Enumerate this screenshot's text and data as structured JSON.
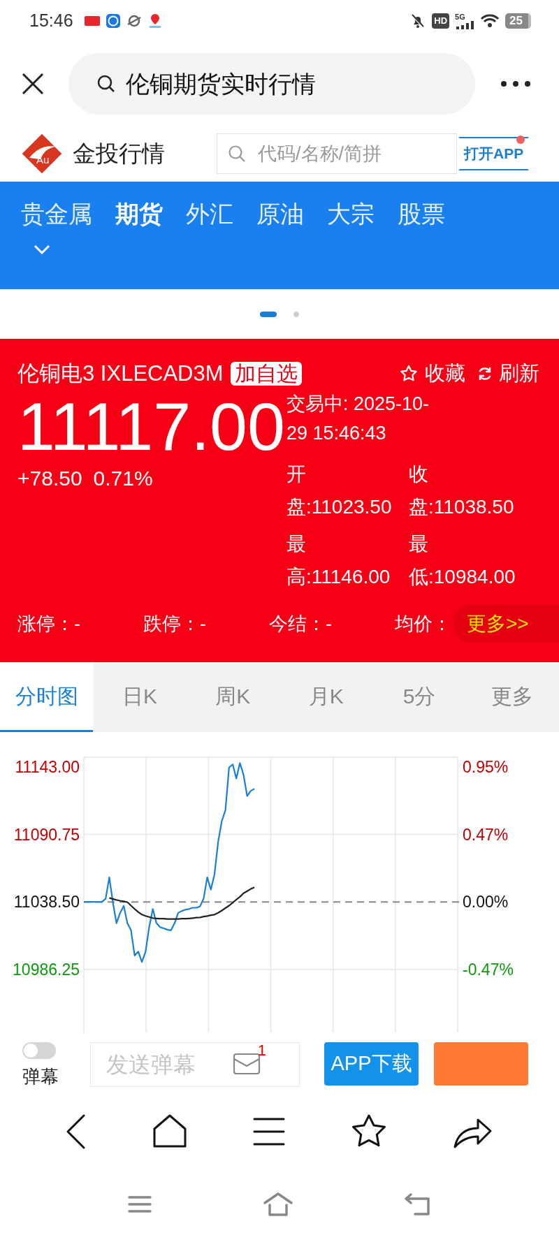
{
  "status_bar": {
    "time": "15:46",
    "hd": "HD",
    "network": "5G",
    "battery": "25"
  },
  "browser_bar": {
    "query": "伦铜期货实时行情"
  },
  "site_header": {
    "logo_mark": "Au",
    "site_name": "金投行情",
    "search": {
      "placeholder": "代码/名称/简拼"
    },
    "open_app": "打开APP"
  },
  "category_nav": {
    "items": [
      {
        "label": "贵金属",
        "selected": false
      },
      {
        "label": "期货",
        "selected": true
      },
      {
        "label": "外汇",
        "selected": false
      },
      {
        "label": "原油",
        "selected": false
      },
      {
        "label": "大宗",
        "selected": false
      },
      {
        "label": "股票",
        "selected": false
      }
    ]
  },
  "carousel": {
    "pages": [
      {
        "selected": true
      },
      {
        "selected": false
      }
    ]
  },
  "quote": {
    "name": "伦铜电3 IXLECAD3M",
    "watch_button": "加自选",
    "favorite": "收藏",
    "refresh": "刷新",
    "price": "11117.00",
    "change": "+78.50",
    "change_pct": "0.71%",
    "status": "交易中: 2025-10-29 15:46:43",
    "stats": [
      "开盘:11023.50",
      "收盘:11038.50",
      "最高:11146.00",
      "最低:10984.00"
    ],
    "limits": [
      "涨停：-",
      "跌停：-",
      "今结：-",
      "均价："
    ],
    "more": "更多>>"
  },
  "chart_tabs": [
    {
      "label": "分时图",
      "selected": true
    },
    {
      "label": "日K",
      "selected": false
    },
    {
      "label": "周K",
      "selected": false
    },
    {
      "label": "月K",
      "selected": false
    },
    {
      "label": "5分",
      "selected": false
    },
    {
      "label": "更多",
      "selected": false
    }
  ],
  "chart": {
    "chart_data": {
      "type": "line",
      "ylim": [
        10938,
        11150.5
      ],
      "yticks": [
        {
          "value": 11143,
          "label": "11143.00"
        },
        {
          "value": 11090.75,
          "label": "11090.75"
        },
        {
          "value": 11038.5,
          "label": "11038.50"
        },
        {
          "value": 10986.25,
          "label": "10986.25"
        }
      ],
      "series": [
        {
          "color": "#1a7fd4",
          "values": [
            11038.5,
            11038.5,
            11038.5,
            11038.5,
            11038.5,
            11038.5,
            11041,
            11057.5,
            11038,
            11022,
            11030,
            11035.5,
            11022,
            11016.5,
            10997,
            11000,
            10992,
            11000,
            11019,
            11033,
            11022,
            11019,
            11018,
            11017,
            11016.5,
            11022,
            11030,
            11031.5,
            11032.5,
            11033,
            11034,
            11034,
            11035,
            11041,
            11057.5,
            11048,
            11060,
            11085,
            11101,
            11109.5,
            11142.5,
            11145,
            11134,
            11146,
            11137,
            11120.5,
            11124.5,
            11126,
            null,
            null,
            null,
            null,
            null,
            null,
            null,
            null,
            null,
            null,
            null,
            null,
            null,
            null,
            null,
            null,
            null,
            null,
            null,
            null,
            null,
            null,
            null,
            null,
            null,
            null,
            null,
            null,
            null,
            null,
            null,
            null,
            null,
            null,
            null,
            null,
            null,
            null,
            null,
            null,
            null,
            null,
            null,
            null,
            null,
            null,
            null,
            null,
            null,
            null,
            null,
            null
          ]
        },
        {
          "color": "#222222",
          "values": [
            null,
            null,
            null,
            null,
            null,
            null,
            null,
            11041.6,
            11040.8,
            11040.0,
            11039.4,
            11038.9,
            11038.3,
            11035.6,
            11033.0,
            11030.7,
            11028.7,
            11027.6,
            11026.8,
            11026.0,
            11025.7,
            11025.5,
            11025.5,
            11025.2,
            11025.2,
            11025.2,
            11025.2,
            11025.5,
            11025.5,
            11025.7,
            11026.0,
            11026.3,
            11026.5,
            11027.1,
            11027.6,
            11028.2,
            11028.7,
            11030.1,
            11031.8,
            11033.7,
            11035.6,
            11037.8,
            11040.3,
            11042.4,
            11045.2,
            11046.8,
            11048.5,
            11049.8,
            null,
            null,
            null,
            null,
            null,
            null,
            null,
            null,
            null,
            null,
            null,
            null,
            null,
            null,
            null,
            null,
            null,
            null,
            null,
            null,
            null,
            null,
            null,
            null,
            null,
            null,
            null,
            null,
            null,
            null,
            null,
            null,
            null,
            null,
            null,
            null,
            null,
            null,
            null,
            null,
            null,
            null,
            null,
            null,
            null,
            null,
            null,
            null,
            null,
            null,
            null,
            null,
            null,
            null,
            null,
            null
          ]
        }
      ],
      "grid": true,
      "ref_lines": [
        {
          "axis": "y",
          "value": 11038.5
        }
      ]
    },
    "right_labels": [
      "0.95%",
      "0.47%",
      "0.00%",
      "-0.47%"
    ]
  },
  "danmaku": {
    "toggle_label": "弹幕",
    "on": false,
    "input": {
      "placeholder": "发送弹幕"
    },
    "unread": "1",
    "download": "APP下载"
  }
}
